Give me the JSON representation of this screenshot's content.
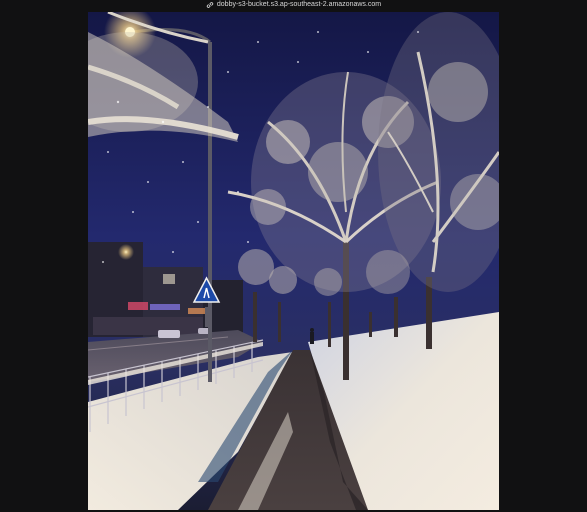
{
  "window": {
    "url": "dobby-s3-bucket.s3.ap-southeast-2.amazonaws.com",
    "link_icon": "link-icon"
  },
  "photo": {
    "subject": "snowy street at night with snow-covered trees, sidewalk, fence and pedestrian crossing sign",
    "sky_color": "#1f2466",
    "snow_color": "#e8e2d8",
    "lamp_color": "#ffd98a"
  }
}
